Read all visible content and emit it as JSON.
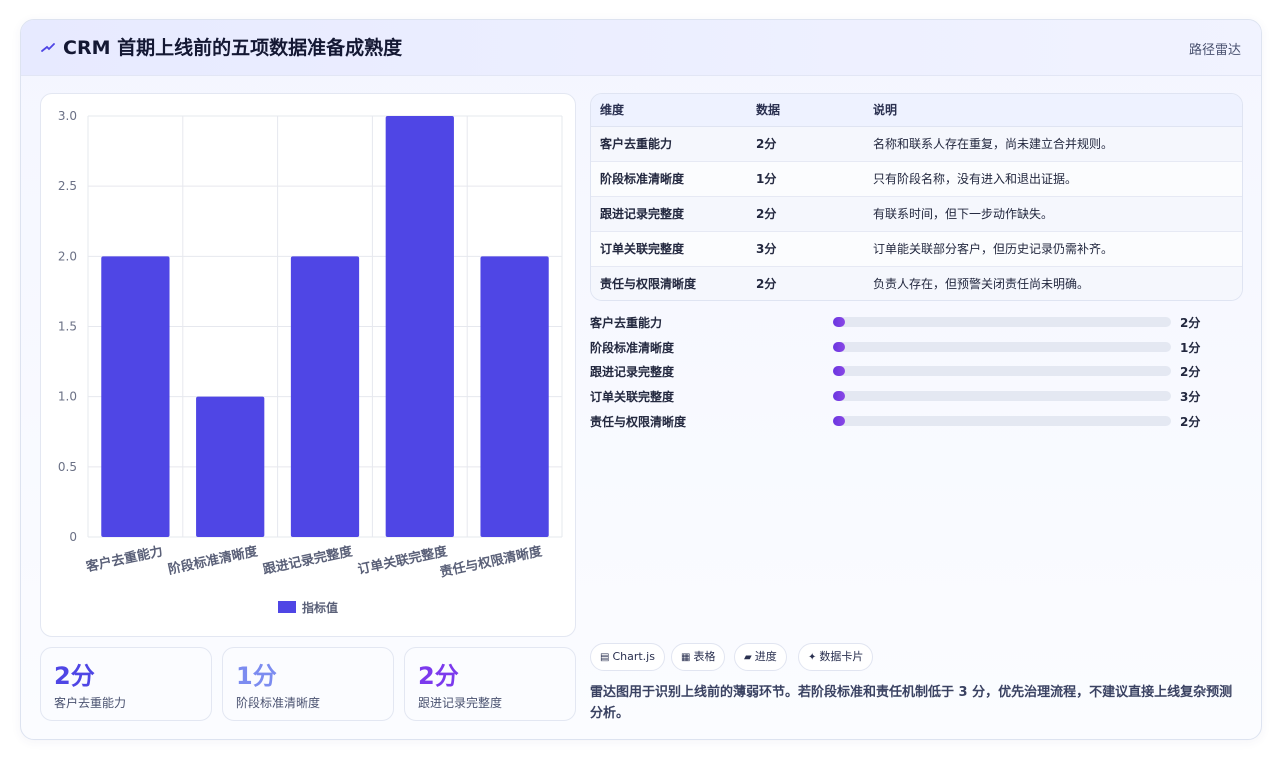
{
  "header": {
    "title": "CRM 首期上线前的五项数据准备成熟度",
    "right_label": "路径雷达"
  },
  "chart_data": {
    "type": "bar",
    "categories": [
      "客户去重能力",
      "阶段标准清晰度",
      "跟进记录完整度",
      "订单关联完整度",
      "责任与权限清晰度"
    ],
    "series": [
      {
        "name": "指标值",
        "values": [
          2,
          1,
          2,
          3,
          2
        ],
        "color": "#4f46e5"
      }
    ],
    "yticks": [
      "0",
      "0.5",
      "1.0",
      "1.5",
      "2.0",
      "2.5",
      "3.0"
    ],
    "ylim": [
      0,
      3
    ],
    "grid": true,
    "legend": "bottom"
  },
  "stats": [
    {
      "value": "2分",
      "label": "客户去重能力",
      "color": "#4f46e5"
    },
    {
      "value": "1分",
      "label": "阶段标准清晰度",
      "color": "#7c8cf0"
    },
    {
      "value": "2分",
      "label": "跟进记录完整度",
      "color": "#7c3aed"
    }
  ],
  "table": {
    "headers": [
      "维度",
      "数据",
      "说明"
    ],
    "rows": [
      [
        "客户去重能力",
        "2分",
        "名称和联系人存在重复，尚未建立合并规则。"
      ],
      [
        "阶段标准清晰度",
        "1分",
        "只有阶段名称，没有进入和退出证据。"
      ],
      [
        "跟进记录完整度",
        "2分",
        "有联系时间，但下一步动作缺失。"
      ],
      [
        "订单关联完整度",
        "3分",
        "订单能关联部分客户，但历史记录仍需补齐。"
      ],
      [
        "责任与权限清晰度",
        "2分",
        "负责人存在，但预警关闭责任尚未明确。"
      ]
    ]
  },
  "progress": [
    {
      "label": "客户去重能力",
      "value_text": "2分",
      "fraction": 0.02
    },
    {
      "label": "阶段标准清晰度",
      "value_text": "1分",
      "fraction": 0.01
    },
    {
      "label": "跟进记录完整度",
      "value_text": "2分",
      "fraction": 0.02
    },
    {
      "label": "订单关联完整度",
      "value_text": "3分",
      "fraction": 0.03
    },
    {
      "label": "责任与权限清晰度",
      "value_text": "2分",
      "fraction": 0.02
    }
  ],
  "tags": [
    {
      "icon": "chart-icon",
      "glyph": "▤",
      "label": "Chart.js"
    },
    {
      "icon": "table-icon",
      "glyph": "▦",
      "label": "表格"
    },
    {
      "icon": "progress-icon",
      "glyph": "▰",
      "label": "进度"
    },
    {
      "icon": "sparkle-icon",
      "glyph": "✦",
      "label": "数据卡片"
    }
  ],
  "note": "雷达图用于识别上线前的薄弱环节。若阶段标准和责任机制低于 3 分，优先治理流程，不建议直接上线复杂预测分析。"
}
